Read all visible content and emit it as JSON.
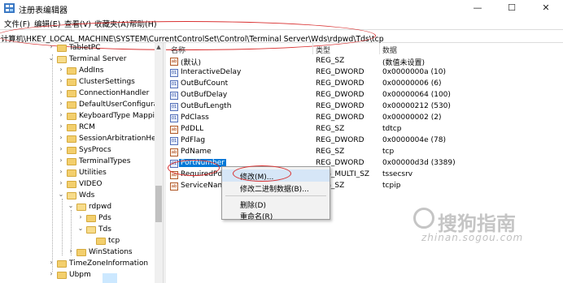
{
  "window": {
    "title": "注册表编辑器",
    "min_glyph": "—",
    "max_glyph": "☐",
    "close_glyph": "✕"
  },
  "menu": [
    "文件(F)",
    "编辑(E)",
    "查看(V)",
    "收藏夹(A)",
    "帮助(H)"
  ],
  "address": "计算机\\HKEY_LOCAL_MACHINE\\SYSTEM\\CurrentControlSet\\Control\\Terminal Server\\Wds\\rdpwd\\Tds\\tcp",
  "tree": [
    {
      "label": "TabletPC",
      "chev": "›"
    },
    {
      "label": "Terminal Server",
      "chev": "⌄"
    },
    {
      "label": "AddIns",
      "chev": "›"
    },
    {
      "label": "ClusterSettings",
      "chev": "›"
    },
    {
      "label": "ConnectionHandler",
      "chev": "›"
    },
    {
      "label": "DefaultUserConfigurati",
      "chev": "›"
    },
    {
      "label": "KeyboardType Mapping",
      "chev": "›"
    },
    {
      "label": "RCM",
      "chev": "›"
    },
    {
      "label": "SessionArbitrationHelpe",
      "chev": "›"
    },
    {
      "label": "SysProcs",
      "chev": "›"
    },
    {
      "label": "TerminalTypes",
      "chev": "›"
    },
    {
      "label": "Utilities",
      "chev": "›"
    },
    {
      "label": "VIDEO",
      "chev": "›"
    },
    {
      "label": "Wds",
      "chev": "⌄"
    },
    {
      "label": "rdpwd",
      "chev": "⌄"
    },
    {
      "label": "Pds",
      "chev": "›"
    },
    {
      "label": "Tds",
      "chev": "⌄"
    },
    {
      "label": "tcp",
      "chev": ""
    },
    {
      "label": "WinStations",
      "chev": "›"
    },
    {
      "label": "TimeZoneInformation",
      "chev": "›"
    },
    {
      "label": "Ubpm",
      "chev": "›"
    }
  ],
  "columns": {
    "name": "名称",
    "type": "类型",
    "data": "数据"
  },
  "values": [
    {
      "name": "(默认)",
      "type": "REG_SZ",
      "data": "(数值未设置)",
      "kind": "ab"
    },
    {
      "name": "InteractiveDelay",
      "type": "REG_DWORD",
      "data": "0x0000000a (10)",
      "kind": "bin"
    },
    {
      "name": "OutBufCount",
      "type": "REG_DWORD",
      "data": "0x00000006 (6)",
      "kind": "bin"
    },
    {
      "name": "OutBufDelay",
      "type": "REG_DWORD",
      "data": "0x00000064 (100)",
      "kind": "bin"
    },
    {
      "name": "OutBufLength",
      "type": "REG_DWORD",
      "data": "0x00000212 (530)",
      "kind": "bin"
    },
    {
      "name": "PdClass",
      "type": "REG_DWORD",
      "data": "0x00000002 (2)",
      "kind": "bin"
    },
    {
      "name": "PdDLL",
      "type": "REG_SZ",
      "data": "tdtcp",
      "kind": "ab"
    },
    {
      "name": "PdFlag",
      "type": "REG_DWORD",
      "data": "0x0000004e (78)",
      "kind": "bin"
    },
    {
      "name": "PdName",
      "type": "REG_SZ",
      "data": "tcp",
      "kind": "ab"
    },
    {
      "name": "PortNumber",
      "type": "REG_DWORD",
      "data": "0x00000d3d (3389)",
      "kind": "bin"
    },
    {
      "name": "RequiredPds",
      "type": "REG_MULTI_SZ",
      "data": "tssecsrv",
      "kind": "ab"
    },
    {
      "name": "ServiceName",
      "type": "REG_SZ",
      "data": "tcpip",
      "kind": "ab"
    }
  ],
  "context_menu": [
    "修改(M)...",
    "修改二进制数据(B)...",
    "删除(D)",
    "重命名(R)"
  ],
  "watermark": {
    "text": "搜狗指南",
    "url": "zhinan.sogou.com"
  },
  "colors": {
    "selection": "#0078d7",
    "annotation": "#d93030",
    "folder": "#f3cf6d"
  }
}
